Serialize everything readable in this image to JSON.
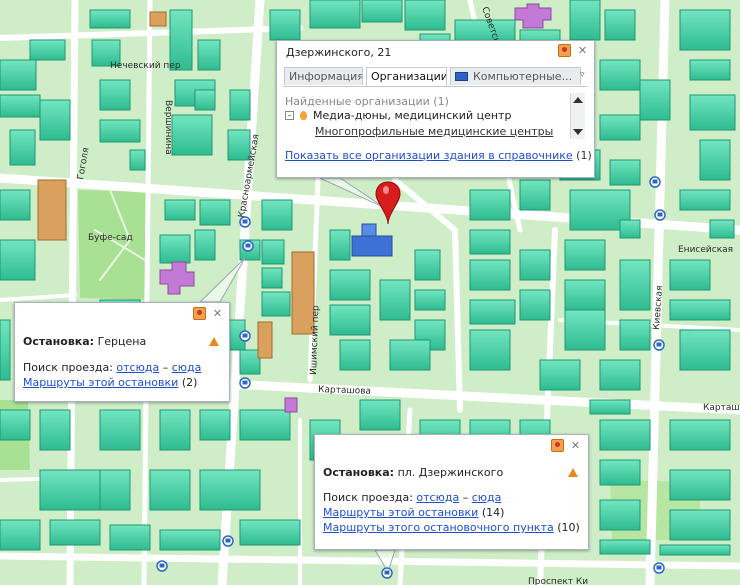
{
  "map": {
    "streets": {
      "nechevsky": "Нечевский пер",
      "vershinina": "Вершинина",
      "gogolya": "Гоголя",
      "krasnoarmeyskaya": "Красноармейская",
      "ishimsky": "Ишимский пер",
      "kartashova": "Карташова",
      "kartashova_right": "Карташ",
      "eniseyskaya": "Енисейская",
      "kievskaya": "Киевская",
      "bufe_sad": "Буфе-сад",
      "vertical_top": "Советская",
      "bottom_street": "Проспект Ки"
    },
    "colors": {
      "background": "#cfeec8",
      "building": "#3ec9a0",
      "building_roof": "#6fe3bd",
      "building_dark": "#1d9873",
      "road": "#ffffff",
      "park": "#a8e094",
      "selected_building": "#3d71d6",
      "marker": "#d81c1c"
    }
  },
  "popup_building": {
    "title": "Дзержинского, 21",
    "tabs": [
      {
        "label": "Информация"
      },
      {
        "label": "Организации"
      },
      {
        "label": "Компьютерные..."
      }
    ],
    "found_label": "Найденные организации (1)",
    "org_name": "Медиа-дюны, медицинский центр",
    "org_category": "Многопрофильные медицинские центры",
    "show_all_link": "Показать все организации здания в справочнике",
    "show_all_count": "(1)"
  },
  "popup_stop1": {
    "label": "Остановка:",
    "name": "Герцена",
    "search_label": "Поиск проезда:",
    "from_link": "отсюда",
    "dash": "–",
    "to_link": "сюда",
    "routes_link": "Маршруты этой остановки",
    "routes_count": "(2)"
  },
  "popup_stop2": {
    "label": "Остановка:",
    "name": "пл. Дзержинского",
    "search_label": "Поиск проезда:",
    "from_link": "отсюда",
    "dash": "–",
    "to_link": "сюда",
    "routes_link": "Маршруты этой остановки",
    "routes_count": "(14)",
    "point_routes_link": "Маршруты этого остановочного пункта",
    "point_routes_count": "(10)"
  }
}
